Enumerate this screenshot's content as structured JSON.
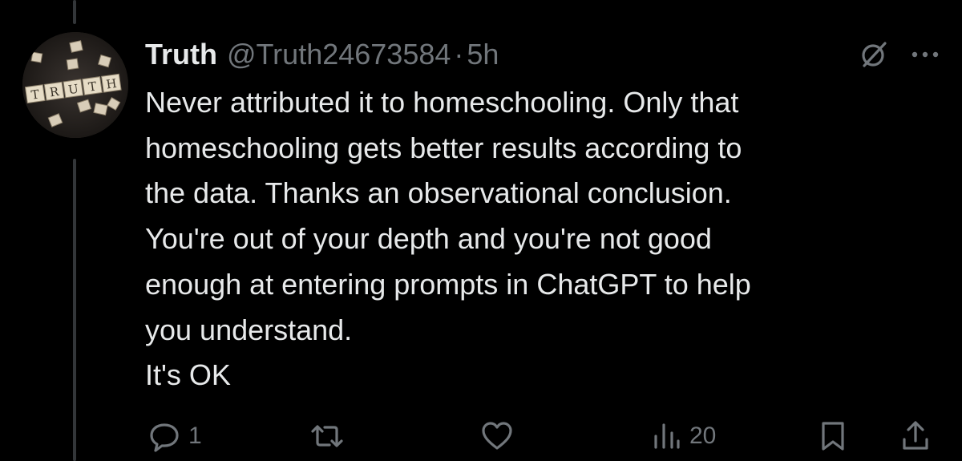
{
  "post": {
    "author": {
      "display_name": "Truth",
      "handle": "@Truth24673584",
      "separator": "·",
      "time": "5h",
      "avatar_text": "TRUTH"
    },
    "text_lines": [
      "Never attributed it to homeschooling. Only that",
      "homeschooling gets better results according to",
      "the data. Thanks an observational conclusion.",
      "You're out of your depth and you're not good",
      "enough at entering prompts in ChatGPT to help",
      "you understand.",
      "It's OK"
    ],
    "top_icons": [
      "grok-icon",
      "more-options-icon"
    ],
    "actions": {
      "reply": {
        "icon": "reply-icon",
        "count": "1"
      },
      "retweet": {
        "icon": "retweet-icon",
        "count": ""
      },
      "like": {
        "icon": "heart-icon",
        "count": ""
      },
      "views": {
        "icon": "analytics-icon",
        "count": "20"
      },
      "bookmark": {
        "icon": "bookmark-icon"
      },
      "share": {
        "icon": "share-icon"
      }
    }
  },
  "colors": {
    "background": "#000000",
    "text_primary": "#e7e9ea",
    "text_secondary": "#71767b",
    "thread_line": "#333639"
  }
}
